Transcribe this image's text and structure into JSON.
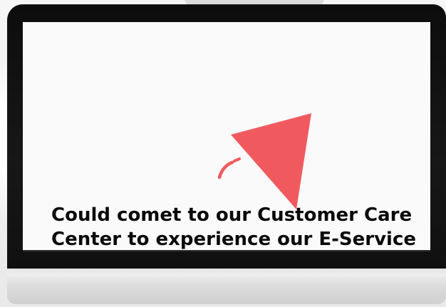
{
  "screen": {
    "headline_lines": [
      "Could comet to our Customer Care",
      "Center to experience our E-Service"
    ]
  },
  "colors": {
    "accent": "#f05a5f",
    "bezel": "#111111",
    "text": "#0a0a0a"
  },
  "icons": {
    "graphic": "red-triangle-icon",
    "accent_arc": "curved-arc-icon"
  }
}
